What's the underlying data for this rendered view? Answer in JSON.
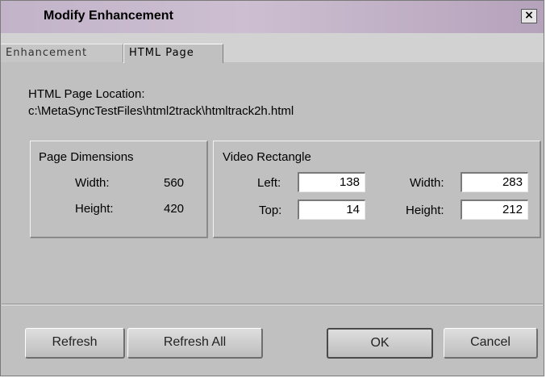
{
  "window": {
    "title": "Modify Enhancement",
    "close_label": "×"
  },
  "tabs": [
    {
      "label": "Enhancement",
      "active": false
    },
    {
      "label": "HTML Page",
      "active": true
    }
  ],
  "location": {
    "label": "HTML Page Location:",
    "path": "c:\\MetaSyncTestFiles\\html2track\\htmltrack2h.html"
  },
  "page_dimensions": {
    "title": "Page Dimensions",
    "width_label": "Width:",
    "width_value": "560",
    "height_label": "Height:",
    "height_value": "420"
  },
  "video_rectangle": {
    "title": "Video Rectangle",
    "left_label": "Left:",
    "left_value": "138",
    "top_label": "Top:",
    "top_value": "14",
    "width_label": "Width:",
    "width_value": "283",
    "height_label": "Height:",
    "height_value": "212"
  },
  "buttons": {
    "refresh": "Refresh",
    "refresh_all": "Refresh All",
    "ok": "OK",
    "cancel": "Cancel"
  }
}
